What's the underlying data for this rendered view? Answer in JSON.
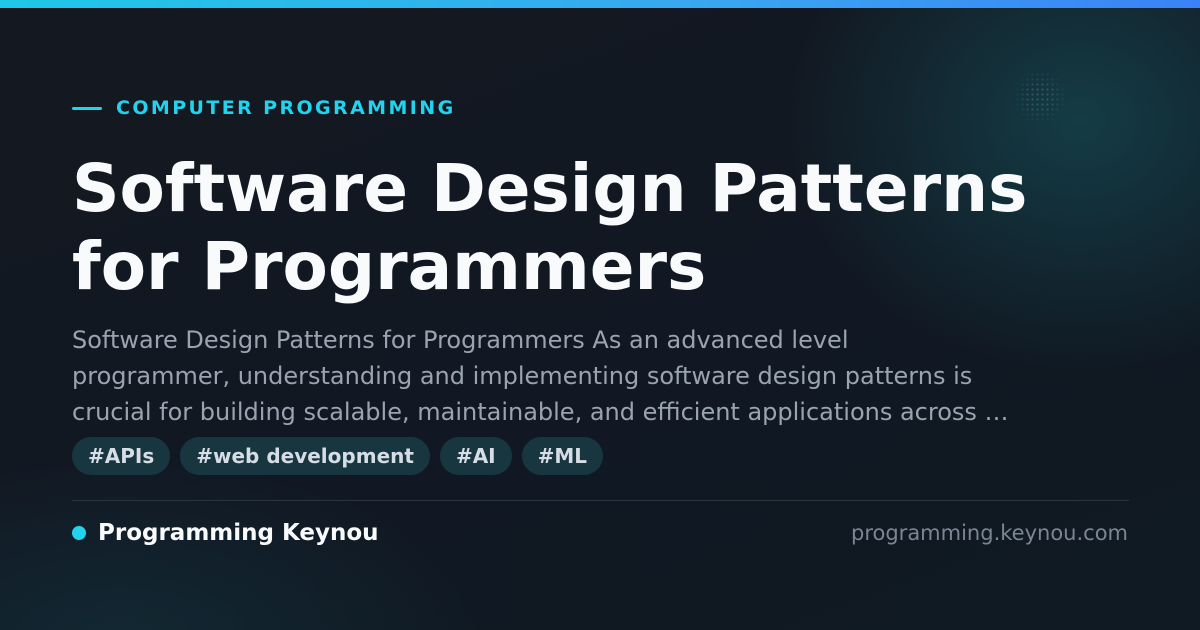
{
  "card": {
    "category": "COMPUTER PROGRAMMING",
    "title_lines": [
      "Software Design Patterns",
      "for Programmers"
    ],
    "description_lines": [
      "Software Design Patterns for Programmers As an advanced level",
      "programmer, understanding and implementing software design patterns is",
      "crucial for building scalable, maintainable, and efficient applications across …"
    ],
    "tags": [
      "#APIs",
      "#web development",
      "#AI",
      "#ML"
    ],
    "brand_name": "Programming Keynou",
    "domain": "programming.keynou.com"
  },
  "colors": {
    "accent": "#22d3ee",
    "background": "#12161d",
    "title": "#f8fafc",
    "description": "#9aa4b1",
    "tag_background": "#183640",
    "top_bar_start": "#1fc8e6",
    "top_bar_end": "#3b82f6"
  }
}
